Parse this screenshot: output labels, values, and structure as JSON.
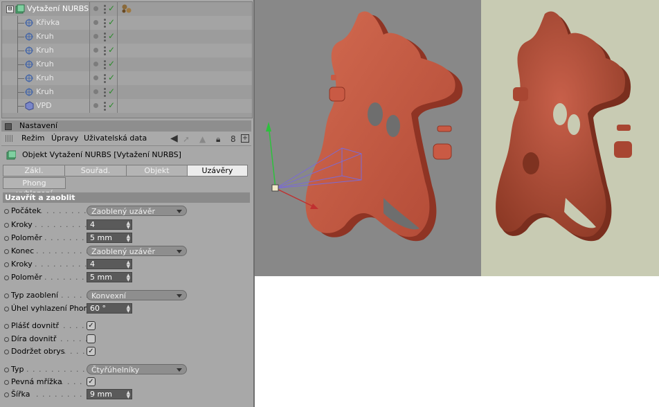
{
  "object_manager": {
    "objects": [
      {
        "name": "Vytažení NURBS",
        "kind": "root"
      },
      {
        "name": "Křivka",
        "kind": "child"
      },
      {
        "name": "Kruh",
        "kind": "child"
      },
      {
        "name": "Kruh",
        "kind": "child"
      },
      {
        "name": "Kruh",
        "kind": "child"
      },
      {
        "name": "Kruh",
        "kind": "child"
      },
      {
        "name": "Kruh",
        "kind": "child"
      },
      {
        "name": "VPD",
        "kind": "child"
      }
    ],
    "expander_glyph": "⊟"
  },
  "attribute_manager": {
    "panel_title": "Nastavení",
    "menu": {
      "mode": "Režim",
      "edit": "Úpravy",
      "user_data": "Uživatelská data"
    },
    "object_title": "Objekt Vytažení NURBS [Vytažení NURBS]",
    "tabs": [
      "Zákl.",
      "Souřad.",
      "Objekt",
      "Uzávěry"
    ],
    "active_tab": "Uzávěry",
    "tab_row2": "Phong vyhlazení",
    "section": "Uzavřít a zaoblit",
    "props": {
      "start": {
        "label": "Počátek",
        "value": "Zaoblený uzávěr"
      },
      "start_steps": {
        "label": "Kroky",
        "value": "4"
      },
      "start_radius": {
        "label": "Poloměr",
        "value": "5 mm"
      },
      "end": {
        "label": "Konec",
        "value": "Zaoblený uzávěr"
      },
      "end_steps": {
        "label": "Kroky",
        "value": "4"
      },
      "end_radius": {
        "label": "Poloměr",
        "value": "5 mm"
      },
      "fillet_type": {
        "label": "Typ zaoblení",
        "value": "Konvexní"
      },
      "phong_angle": {
        "label": "Úhel vyhlazení Phong",
        "value": "60 °"
      },
      "hull_inward": {
        "label": "Plášť dovnitř",
        "checked": true
      },
      "hole_inward": {
        "label": "Díra dovnitř",
        "checked": false
      },
      "constrain": {
        "label": "Dodržet obrys",
        "checked": true
      },
      "type": {
        "label": "Typ",
        "value": "Čtyřúhelníky"
      },
      "regular_grid": {
        "label": "Pevná mřížka",
        "checked": true
      },
      "width": {
        "label": "Šířka",
        "value": "9 mm"
      }
    }
  },
  "colors": {
    "shape": "#c95a44",
    "viewport_bg": "#888888",
    "render_bg": "#c8cbb3",
    "check": "#2a8a2a"
  }
}
